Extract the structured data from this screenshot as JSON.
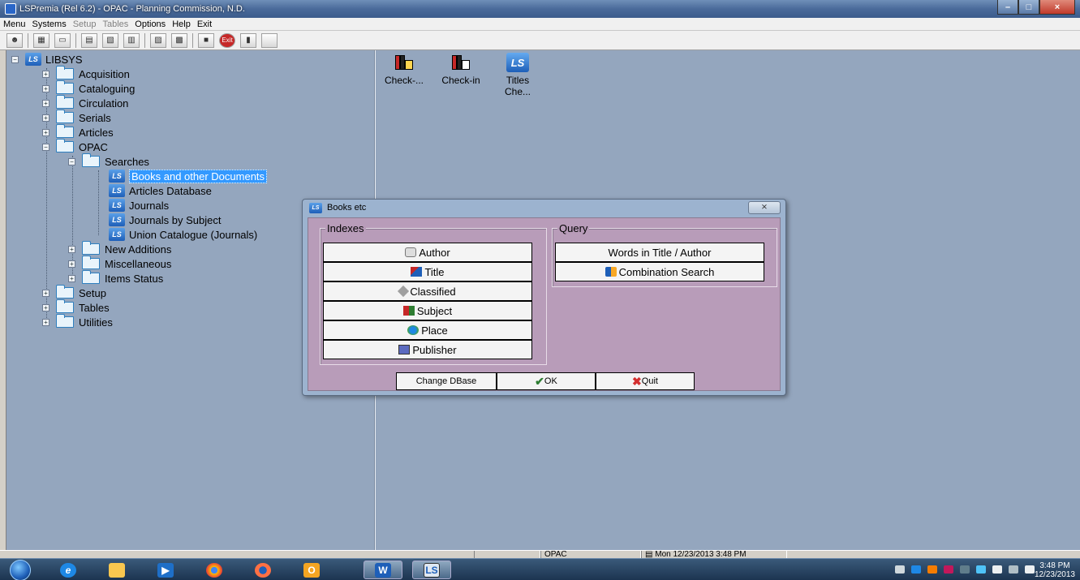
{
  "window": {
    "title": "LSPremia (Rel 6.2) - OPAC - Planning Commission, N.D."
  },
  "menubar": {
    "items": [
      {
        "label": "Menu",
        "enabled": true
      },
      {
        "label": "Systems",
        "enabled": true
      },
      {
        "label": "Setup",
        "enabled": false
      },
      {
        "label": "Tables",
        "enabled": false
      },
      {
        "label": "Options",
        "enabled": true
      },
      {
        "label": "Help",
        "enabled": true
      },
      {
        "label": "Exit",
        "enabled": true
      }
    ]
  },
  "toolbar": {
    "exit_label": "Exit"
  },
  "tree": {
    "root": "LIBSYS",
    "items": [
      {
        "label": "Acquisition"
      },
      {
        "label": "Cataloguing"
      },
      {
        "label": "Circulation"
      },
      {
        "label": "Serials"
      },
      {
        "label": "Articles"
      },
      {
        "label": "OPAC"
      },
      {
        "label": "Searches"
      },
      {
        "label": "Books and other Documents"
      },
      {
        "label": "Articles Database"
      },
      {
        "label": "Journals"
      },
      {
        "label": "Journals by Subject"
      },
      {
        "label": "Union Catalogue (Journals)"
      },
      {
        "label": "New Additions"
      },
      {
        "label": "Miscellaneous"
      },
      {
        "label": "Items Status"
      },
      {
        "label": "Setup"
      },
      {
        "label": "Tables"
      },
      {
        "label": "Utilities"
      }
    ],
    "selected": "Books and other Documents"
  },
  "icons": {
    "items": [
      {
        "label_line1": "Check-...",
        "label_line2": ""
      },
      {
        "label_line1": "Check-in",
        "label_line2": ""
      },
      {
        "label_line1": "Titles",
        "label_line2": "Che..."
      }
    ]
  },
  "dialog": {
    "title": "Books etc",
    "close_label": "⨯",
    "indexes": {
      "label": "Indexes",
      "buttons": [
        "Author",
        "Title",
        "Classified",
        "Subject",
        "Place",
        "Publisher"
      ]
    },
    "query": {
      "label": "Query",
      "buttons": [
        "Words in Title / Author",
        "Combination Search"
      ]
    },
    "footer": {
      "change_db": "Change DBase",
      "ok": "OK",
      "quit": "Quit"
    }
  },
  "statusbar": {
    "module": "OPAC",
    "datetime": "Mon 12/23/2013 3:48 PM"
  },
  "taskbar": {
    "time": "3:48 PM",
    "date": "12/23/2013",
    "word_label": "W",
    "libsys_label": "LS"
  }
}
